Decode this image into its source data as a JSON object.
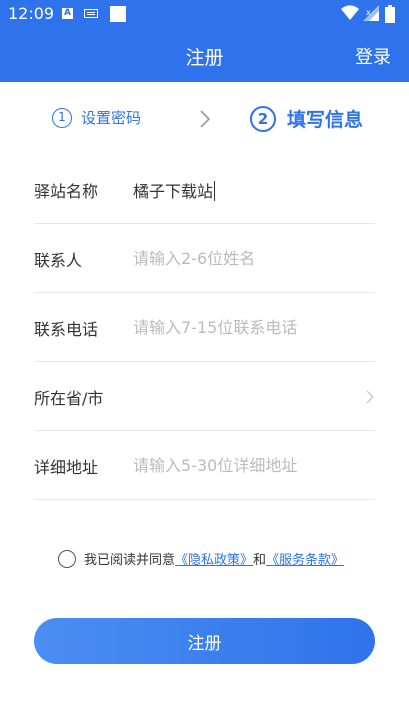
{
  "status_bar": {
    "time": "12:09",
    "icon_a": "A"
  },
  "app_bar": {
    "title": "注册",
    "login_label": "登录"
  },
  "steps": [
    {
      "number": "1",
      "label": "设置密码"
    },
    {
      "number": "2",
      "label": "填写信息"
    }
  ],
  "form": {
    "station_name": {
      "label": "驿站名称",
      "value": "橘子下载站"
    },
    "contact": {
      "label": "联系人",
      "placeholder": "请输入2-6位姓名"
    },
    "phone": {
      "label": "联系电话",
      "placeholder": "请输入7-15位联系电话"
    },
    "region": {
      "label": "所在省/市"
    },
    "address": {
      "label": "详细地址",
      "placeholder": "请输入5-30位详细地址"
    }
  },
  "agreement": {
    "prefix": "我已阅读并同意",
    "privacy": "《隐私政策》",
    "and": "和",
    "terms": "《服务条款》"
  },
  "submit_label": "注册",
  "colors": {
    "primary": "#2f73ec"
  }
}
